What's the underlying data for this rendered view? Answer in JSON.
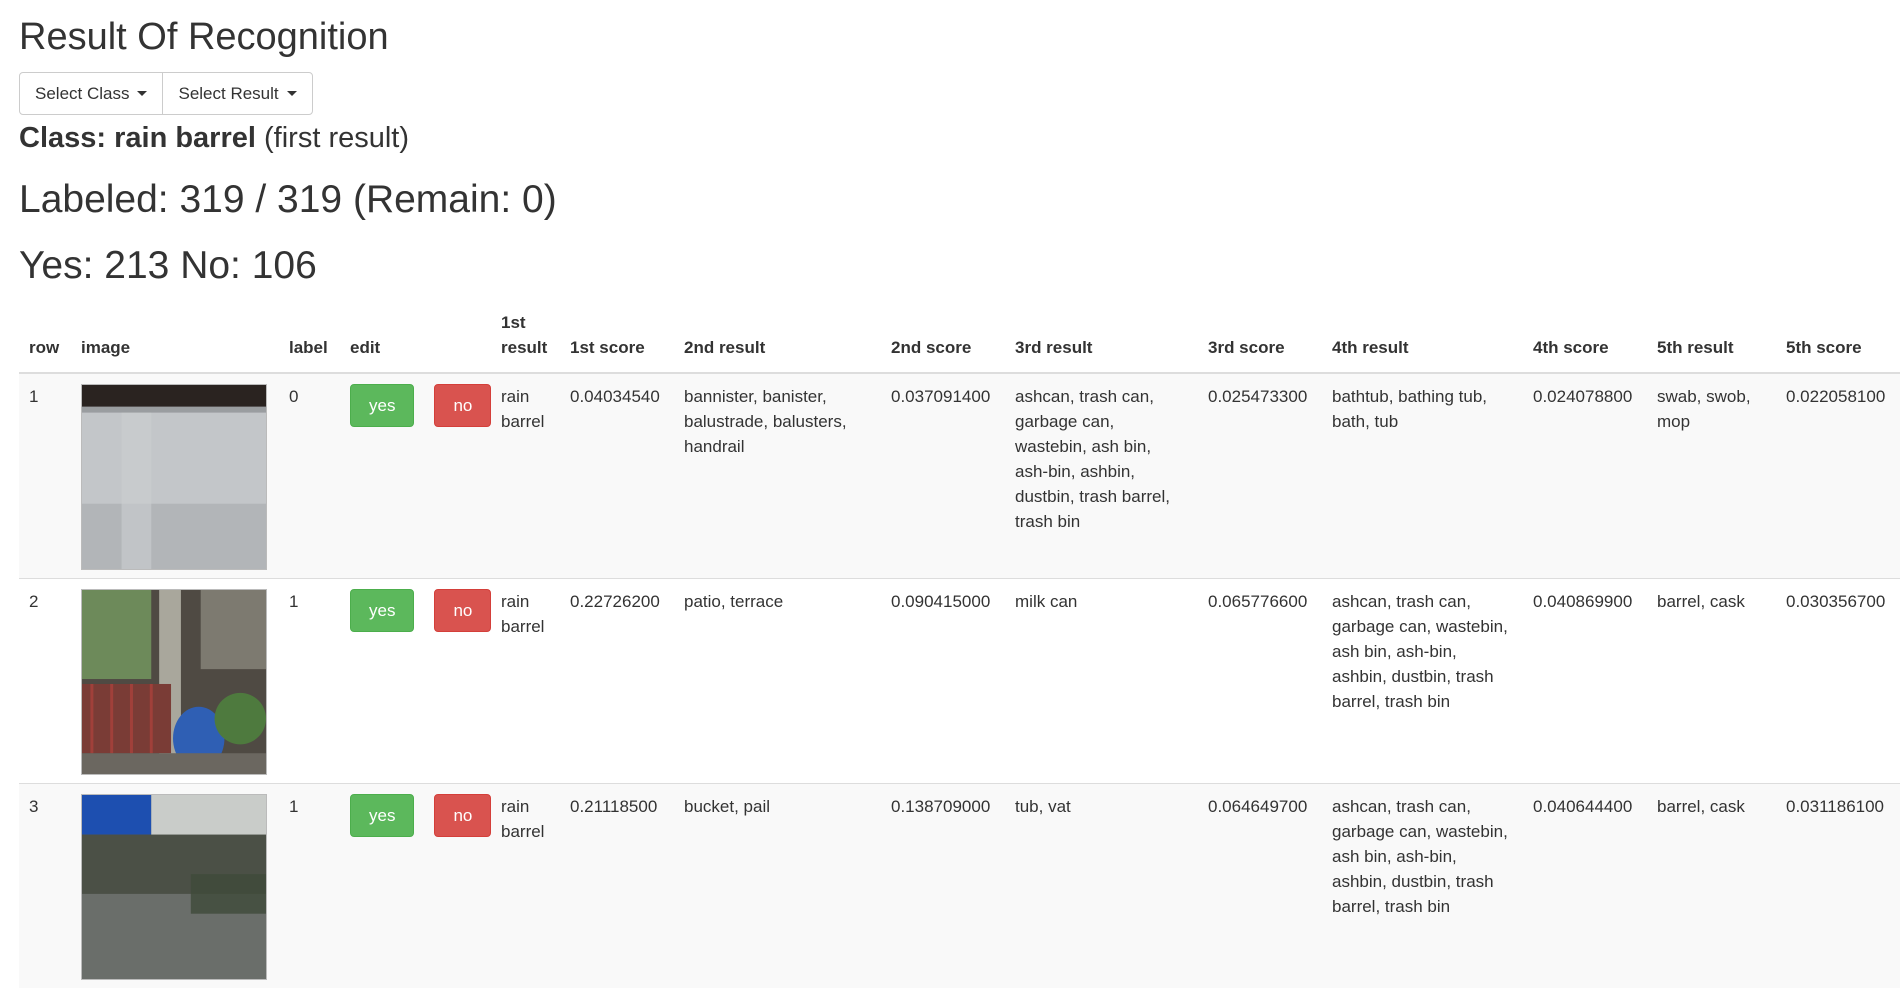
{
  "page": {
    "title": "Result Of Recognition",
    "select_class_label": "Select Class",
    "select_result_label": "Select Result",
    "class_prefix": "Class: rain barrel",
    "class_suffix": " (first result)",
    "labeled_text": "Labeled: 319 / 319 (Remain: 0)",
    "yes_no_text": "Yes: 213 No: 106"
  },
  "table": {
    "headers": {
      "row": "row",
      "image": "image",
      "label": "label",
      "edit": "edit",
      "r1": "1st result",
      "s1": "1st score",
      "r2": "2nd result",
      "s2": "2nd score",
      "r3": "3rd result",
      "s3": "3rd score",
      "r4": "4th result",
      "s4": "4th score",
      "r5": "5th result",
      "s5": "5th score"
    },
    "rows": [
      {
        "row": "1",
        "label": "0",
        "yes": "yes",
        "no": "no",
        "r1": "rain barrel",
        "s1": "0.04034540",
        "r2": "bannister, banister, balustrade, balusters, handrail",
        "s2": "0.037091400",
        "r3": "ashcan, trash can, garbage can, wastebin, ash bin, ash-bin, ashbin, dustbin, trash barrel, trash bin",
        "s3": "0.025473300",
        "r4": "bathtub, bathing tub, bath, tub",
        "s4": "0.024078800",
        "r5": "swab, swob, mop",
        "s5": "0.022058100"
      },
      {
        "row": "2",
        "label": "1",
        "yes": "yes",
        "no": "no",
        "r1": "rain barrel",
        "s1": "0.22726200",
        "r2": "patio, terrace",
        "s2": "0.090415000",
        "r3": "milk can",
        "s3": "0.065776600",
        "r4": "ashcan, trash can, garbage can, wastebin, ash bin, ash-bin, ashbin, dustbin, trash barrel, trash bin",
        "s4": "0.040869900",
        "r5": "barrel, cask",
        "s5": "0.030356700"
      },
      {
        "row": "3",
        "label": "1",
        "yes": "yes",
        "no": "no",
        "r1": "rain barrel",
        "s1": "0.21118500",
        "r2": "bucket, pail",
        "s2": "0.138709000",
        "r3": "tub, vat",
        "s3": "0.064649700",
        "r4": "ashcan, trash can, garbage can, wastebin, ash bin, ash-bin, ashbin, dustbin, trash barrel, trash bin",
        "s4": "0.040644400",
        "r5": "barrel, cask",
        "s5": "0.031186100"
      }
    ]
  },
  "colors": {
    "yes_button": "#5cb85c",
    "no_button": "#d9534f",
    "row_stripe": "#f9f9f9"
  },
  "icons": {
    "dropdown_caret": "chevron-down-icon"
  }
}
